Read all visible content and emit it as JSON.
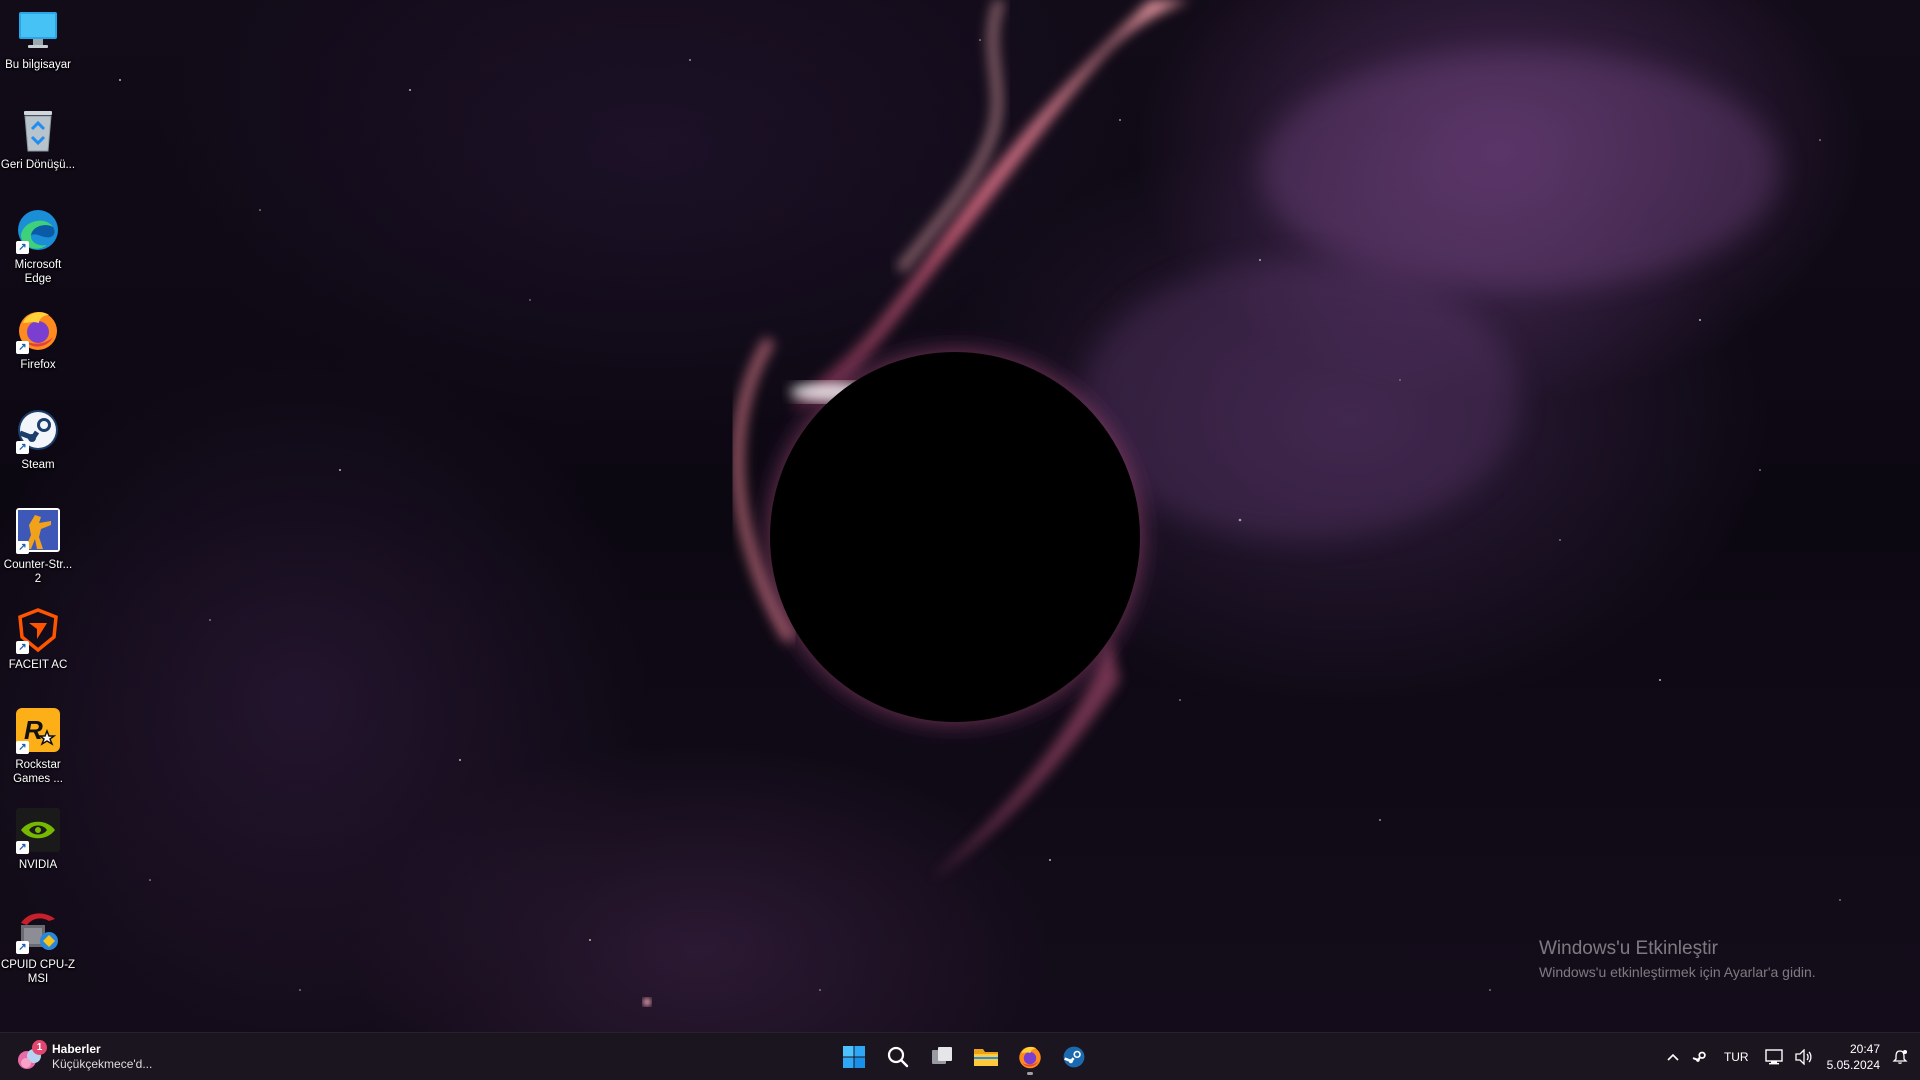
{
  "desktop": {
    "icons": [
      {
        "name": "this-pc",
        "label": "Bu bilgisayar",
        "icon": "monitor-icon",
        "shortcut": false
      },
      {
        "name": "recycle-bin",
        "label": "Geri Dönüşü...",
        "icon": "recycle-bin-icon",
        "shortcut": false
      },
      {
        "name": "microsoft-edge",
        "label": "Microsoft Edge",
        "icon": "edge-icon",
        "shortcut": true
      },
      {
        "name": "firefox",
        "label": "Firefox",
        "icon": "firefox-icon",
        "shortcut": true
      },
      {
        "name": "steam",
        "label": "Steam",
        "icon": "steam-icon",
        "shortcut": true
      },
      {
        "name": "counter-strike-2",
        "label": "Counter-Str... 2",
        "icon": "counter-strike-icon",
        "shortcut": true
      },
      {
        "name": "faceit-ac",
        "label": "FACEIT AC",
        "icon": "faceit-icon",
        "shortcut": true
      },
      {
        "name": "rockstar-games",
        "label": "Rockstar Games ...",
        "icon": "rockstar-icon",
        "shortcut": true
      },
      {
        "name": "nvidia",
        "label": "NVIDIA",
        "icon": "nvidia-icon",
        "shortcut": true
      },
      {
        "name": "cpuid-cpu-z",
        "label": "CPUID CPU-Z MSI",
        "icon": "cpu-z-icon",
        "shortcut": true
      }
    ]
  },
  "activation": {
    "title": "Windows'u Etkinleştir",
    "subtitle": "Windows'u etkinleştirmek için Ayarlar'a gidin."
  },
  "taskbar": {
    "news": {
      "icon": "news-widget-icon",
      "badge": "1",
      "title": "Haberler",
      "subtitle": "Küçükçekmece'd..."
    },
    "center_apps": [
      {
        "name": "start",
        "icon": "windows-start-icon"
      },
      {
        "name": "search",
        "icon": "search-icon"
      },
      {
        "name": "task-view",
        "icon": "task-view-icon"
      },
      {
        "name": "file-explorer",
        "icon": "folder-icon"
      },
      {
        "name": "firefox",
        "icon": "firefox-icon",
        "running": true
      },
      {
        "name": "steam",
        "icon": "steam-icon"
      }
    ],
    "tray": {
      "language": "TUR",
      "time": "20:47",
      "date": "5.05.2024"
    }
  },
  "colors": {
    "taskbar_bg": "#1c1620",
    "accent_glow": "#f07a8c",
    "windows_blue": "#1f8ef0"
  }
}
